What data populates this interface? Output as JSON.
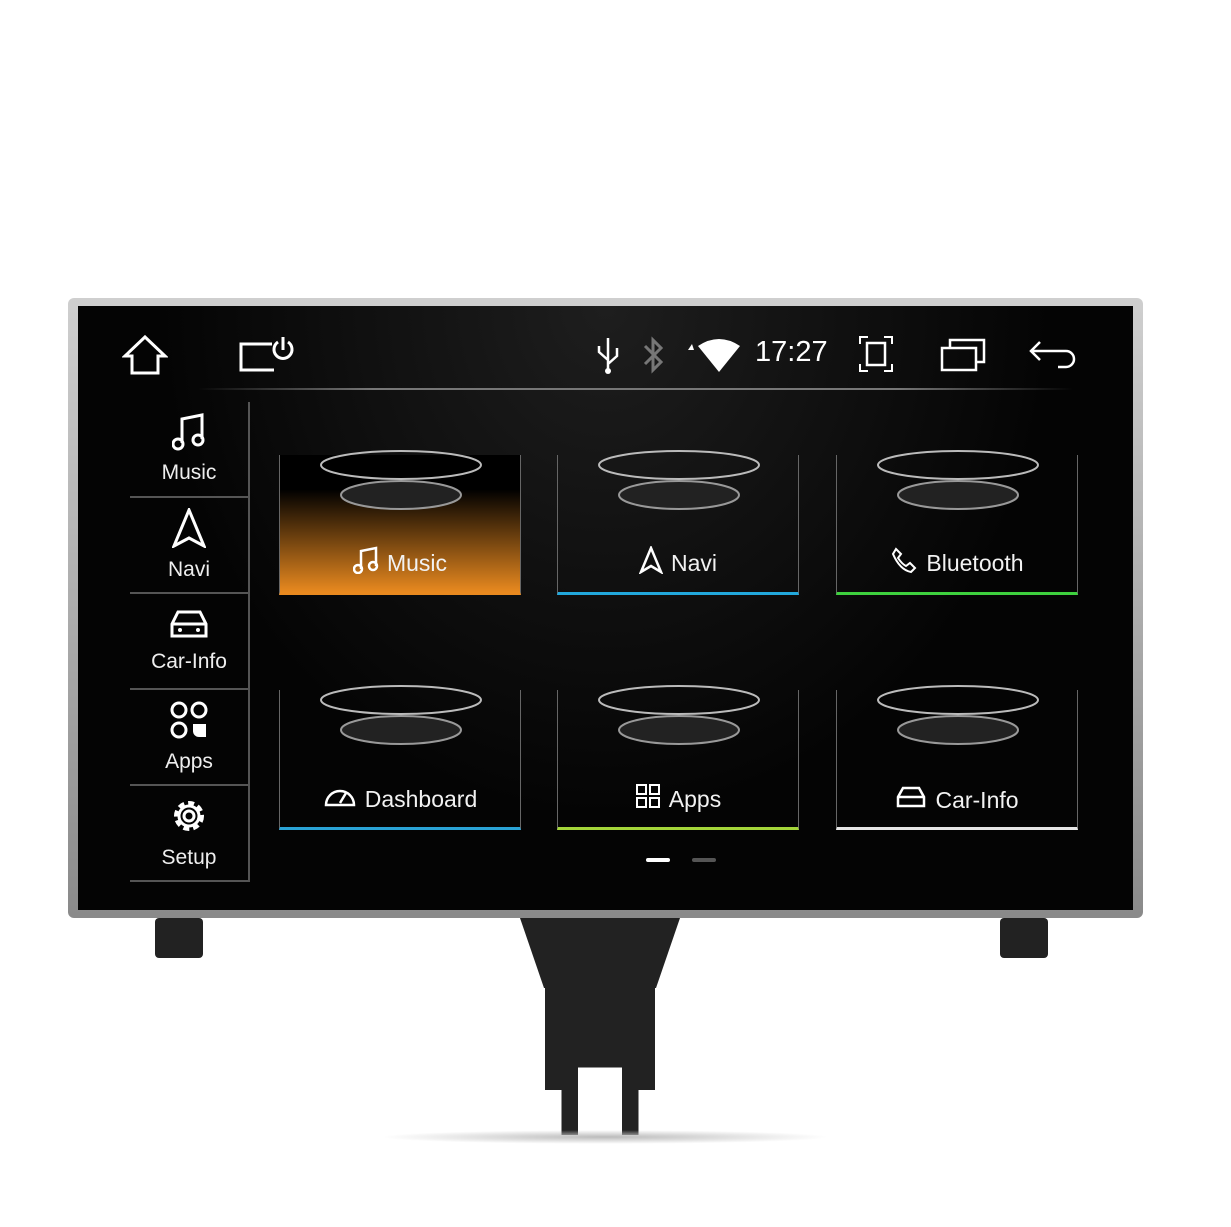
{
  "status_bar": {
    "time": "17:27",
    "icons": [
      "home-icon",
      "power-screen-icon",
      "usb-icon",
      "bluetooth-icon",
      "wifi-icon",
      "screenshot-icon",
      "recent-apps-icon",
      "back-icon"
    ]
  },
  "sidebar": {
    "items": [
      {
        "label": "Music",
        "icon": "music-note-icon"
      },
      {
        "label": "Navi",
        "icon": "navigation-arrow-icon"
      },
      {
        "label": "Car-Info",
        "icon": "car-icon"
      },
      {
        "label": "Apps",
        "icon": "apps-icon"
      },
      {
        "label": "Setup",
        "icon": "gear-icon"
      }
    ]
  },
  "tiles": [
    {
      "label": "Music",
      "icon": "music-note-icon",
      "accent": "#e8891f",
      "selected": true
    },
    {
      "label": "Navi",
      "icon": "navigation-arrow-icon",
      "accent": "#22a8dc"
    },
    {
      "label": "Bluetooth",
      "icon": "phone-icon",
      "accent": "#3ed13e"
    },
    {
      "label": "Dashboard",
      "icon": "speedometer-icon",
      "accent": "#2aa3d6"
    },
    {
      "label": "Apps",
      "icon": "apps-icon",
      "accent": "#a4d63a"
    },
    {
      "label": "Car-Info",
      "icon": "car-icon",
      "accent": "#e6e6e6"
    }
  ],
  "pager": {
    "pages": 2,
    "current": 1
  }
}
